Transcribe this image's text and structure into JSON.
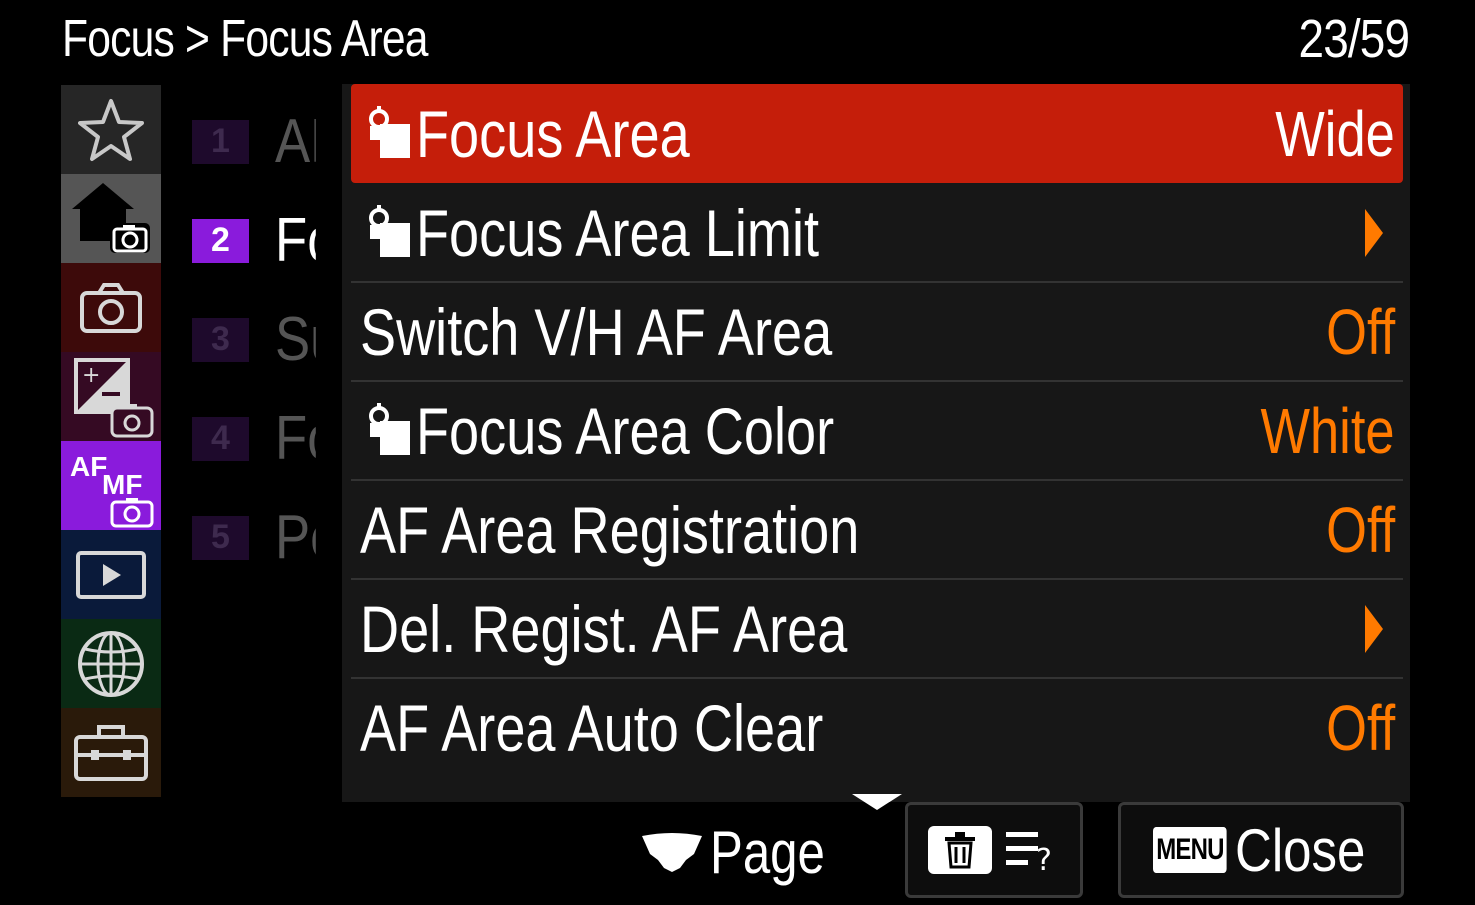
{
  "header": {
    "breadcrumb": "Focus > Focus Area",
    "page_counter": "23/59"
  },
  "categories": [
    {
      "name": "my-menu",
      "icon": "star-icon",
      "bg": "#262626"
    },
    {
      "name": "shooting-main",
      "icon": "home-camera-icon",
      "bg": "#555555"
    },
    {
      "name": "shooting",
      "icon": "camera-icon",
      "bg": "#3d0a0a"
    },
    {
      "name": "exposure-color",
      "icon": "exposure-camera-icon",
      "bg": "#350a23"
    },
    {
      "name": "focus",
      "icon": "af-mf-camera-icon",
      "bg": "#8a1bdc",
      "active": true
    },
    {
      "name": "playback",
      "icon": "play-icon",
      "bg": "#0a1a3a"
    },
    {
      "name": "network",
      "icon": "globe-icon",
      "bg": "#0a2a14"
    },
    {
      "name": "setup",
      "icon": "toolbox-icon",
      "bg": "#2a1a0a"
    }
  ],
  "pages": [
    {
      "num": "1",
      "label": "AF"
    },
    {
      "num": "2",
      "label": "Fo",
      "active": true
    },
    {
      "num": "3",
      "label": "Su"
    },
    {
      "num": "4",
      "label": "Fo"
    },
    {
      "num": "5",
      "label": "Pe"
    }
  ],
  "menu_items": [
    {
      "label": "Focus Area",
      "value": "Wide",
      "icon": "focus-area-icon",
      "selected": true
    },
    {
      "label": "Focus Area Limit",
      "value": "",
      "icon": "focus-area-icon",
      "arrow": true
    },
    {
      "label": "Switch V/H AF Area",
      "value": "Off"
    },
    {
      "label": "Focus Area Color",
      "value": "White",
      "icon": "focus-area-icon"
    },
    {
      "label": "AF Area Registration",
      "value": "Off"
    },
    {
      "label": "Del. Regist. AF Area",
      "value": "",
      "arrow": true
    },
    {
      "label": "AF Area Auto Clear",
      "value": "Off"
    }
  ],
  "footer": {
    "page_label": "Page",
    "menu_button_label": "MENU",
    "close_label": "Close"
  },
  "colors": {
    "selected_row": "#c51e0a",
    "value_orange": "#ff7a00",
    "active_tab": "#8a1bdc"
  }
}
